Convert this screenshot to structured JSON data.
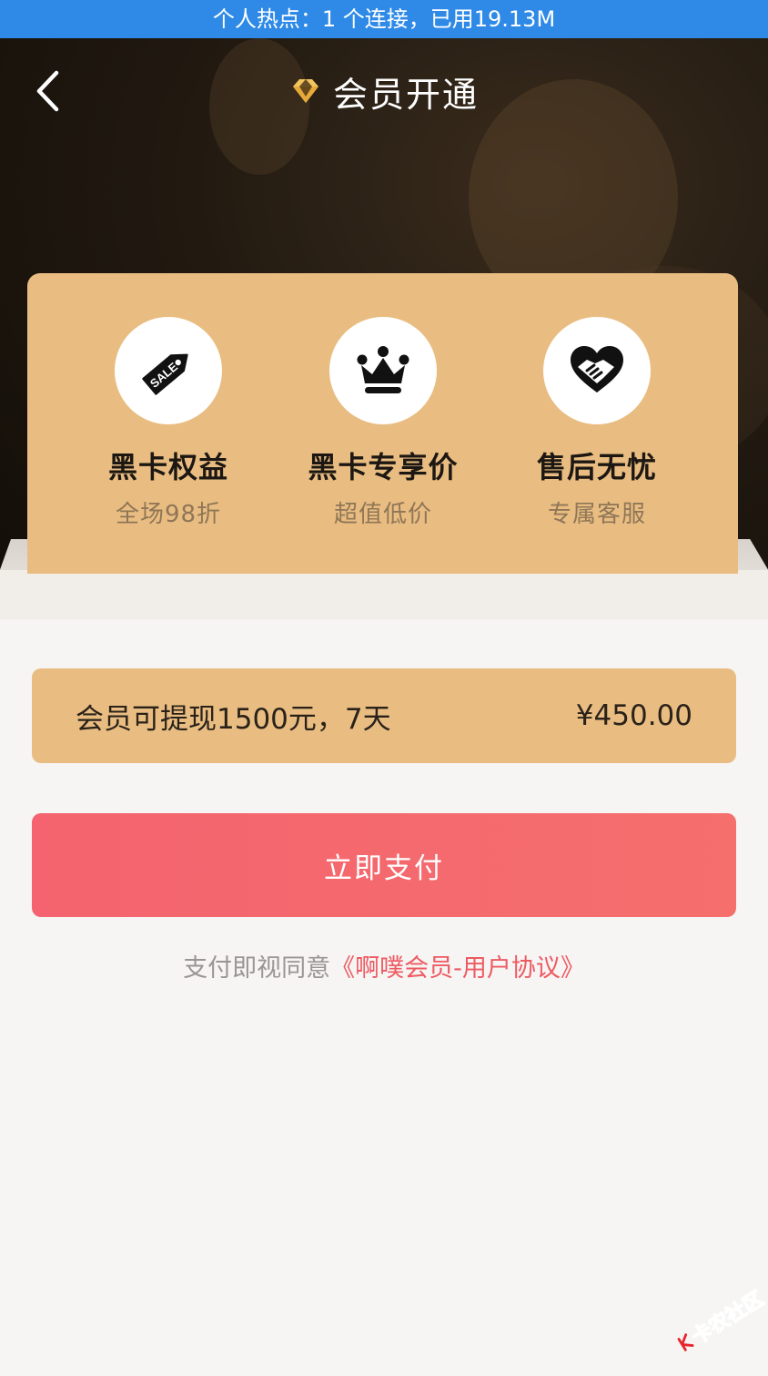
{
  "status_bar": {
    "text": "个人热点：1 个连接，已用19.13M"
  },
  "header": {
    "title": "会员开通",
    "icons": {
      "back": "chevron-left-icon",
      "title": "diamond-icon"
    }
  },
  "benefits": [
    {
      "icon": "sale-tag-icon",
      "title": "黑卡权益",
      "subtitle": "全场98折"
    },
    {
      "icon": "crown-icon",
      "title": "黑卡专享价",
      "subtitle": "超值低价"
    },
    {
      "icon": "heart-handshake-icon",
      "title": "售后无忧",
      "subtitle": "专属客服"
    }
  ],
  "sale_icon_text": "SALE",
  "plan": {
    "name": "会员可提现1500元，7天",
    "price": "¥450.00"
  },
  "pay_button": {
    "label": "立即支付"
  },
  "agreement": {
    "prefix": "支付即视同意",
    "link": "《啊噗会员-用户协议》"
  },
  "watermark": {
    "text": "卡农社区"
  },
  "colors": {
    "status_bar": "#2e8ae6",
    "card_gold": "#e9bd82",
    "pay_red": "#f4636f",
    "link_red": "#ee5a62",
    "page_bg": "#f6f5f4"
  }
}
